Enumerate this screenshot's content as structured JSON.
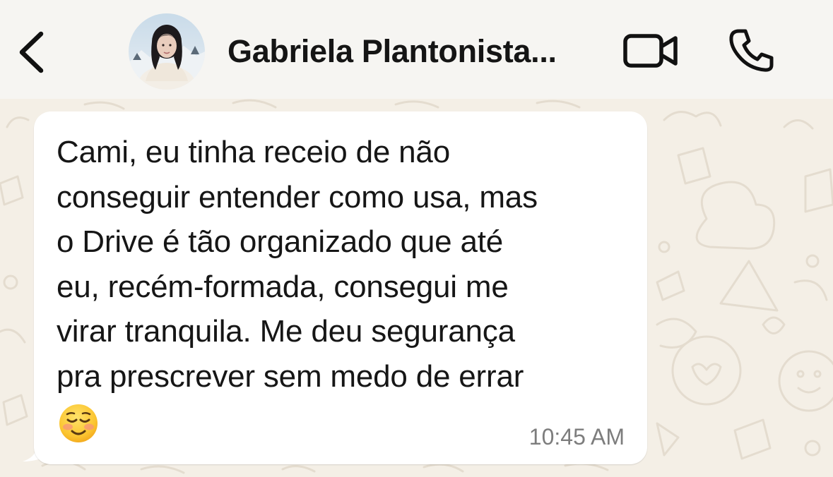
{
  "header": {
    "back_icon": "chevron-left-icon",
    "contact_name": "Gabriela Plantonista...",
    "video_icon": "video-camera-icon",
    "call_icon": "phone-icon"
  },
  "message": {
    "lines": [
      "Cami, eu tinha receio de não",
      "conseguir entender como usa, mas",
      "o Drive é tão organizado que até",
      "eu, recém-formada, consegui me",
      "virar tranquila. Me deu segurança",
      "pra prescrever sem medo de errar"
    ],
    "emoji": "smiling-face-icon",
    "time": "10:45 AM"
  },
  "colors": {
    "header_bg": "#f6f5f2",
    "chat_bg": "#f4efe6",
    "bubble_bg": "#ffffff",
    "text": "#161616",
    "timestamp": "#7d7d7d"
  }
}
